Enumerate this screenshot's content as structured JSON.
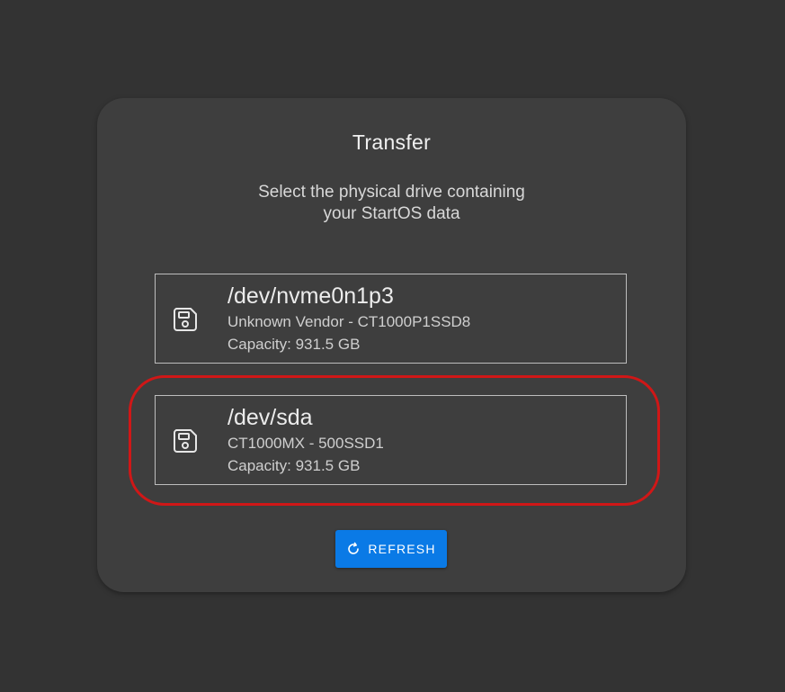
{
  "card": {
    "title": "Transfer",
    "subtitle_line1": "Select the physical drive containing",
    "subtitle_line2": "your StartOS data"
  },
  "drives": [
    {
      "path": "/dev/nvme0n1p3",
      "vendor": "Unknown Vendor - CT1000P1SSD8",
      "capacity": "Capacity: 931.5 GB",
      "icon": "save-icon"
    },
    {
      "path": "/dev/sda",
      "vendor": "CT1000MX - 500SSD1",
      "capacity": "Capacity: 931.5 GB",
      "icon": "save-icon",
      "highlighted": true
    }
  ],
  "refresh": {
    "label": "REFRESH",
    "icon": "refresh-icon"
  },
  "colors": {
    "background": "#333333",
    "card": "#3e3e3e",
    "accent": "#0a7ae6",
    "highlight": "#d01717"
  }
}
